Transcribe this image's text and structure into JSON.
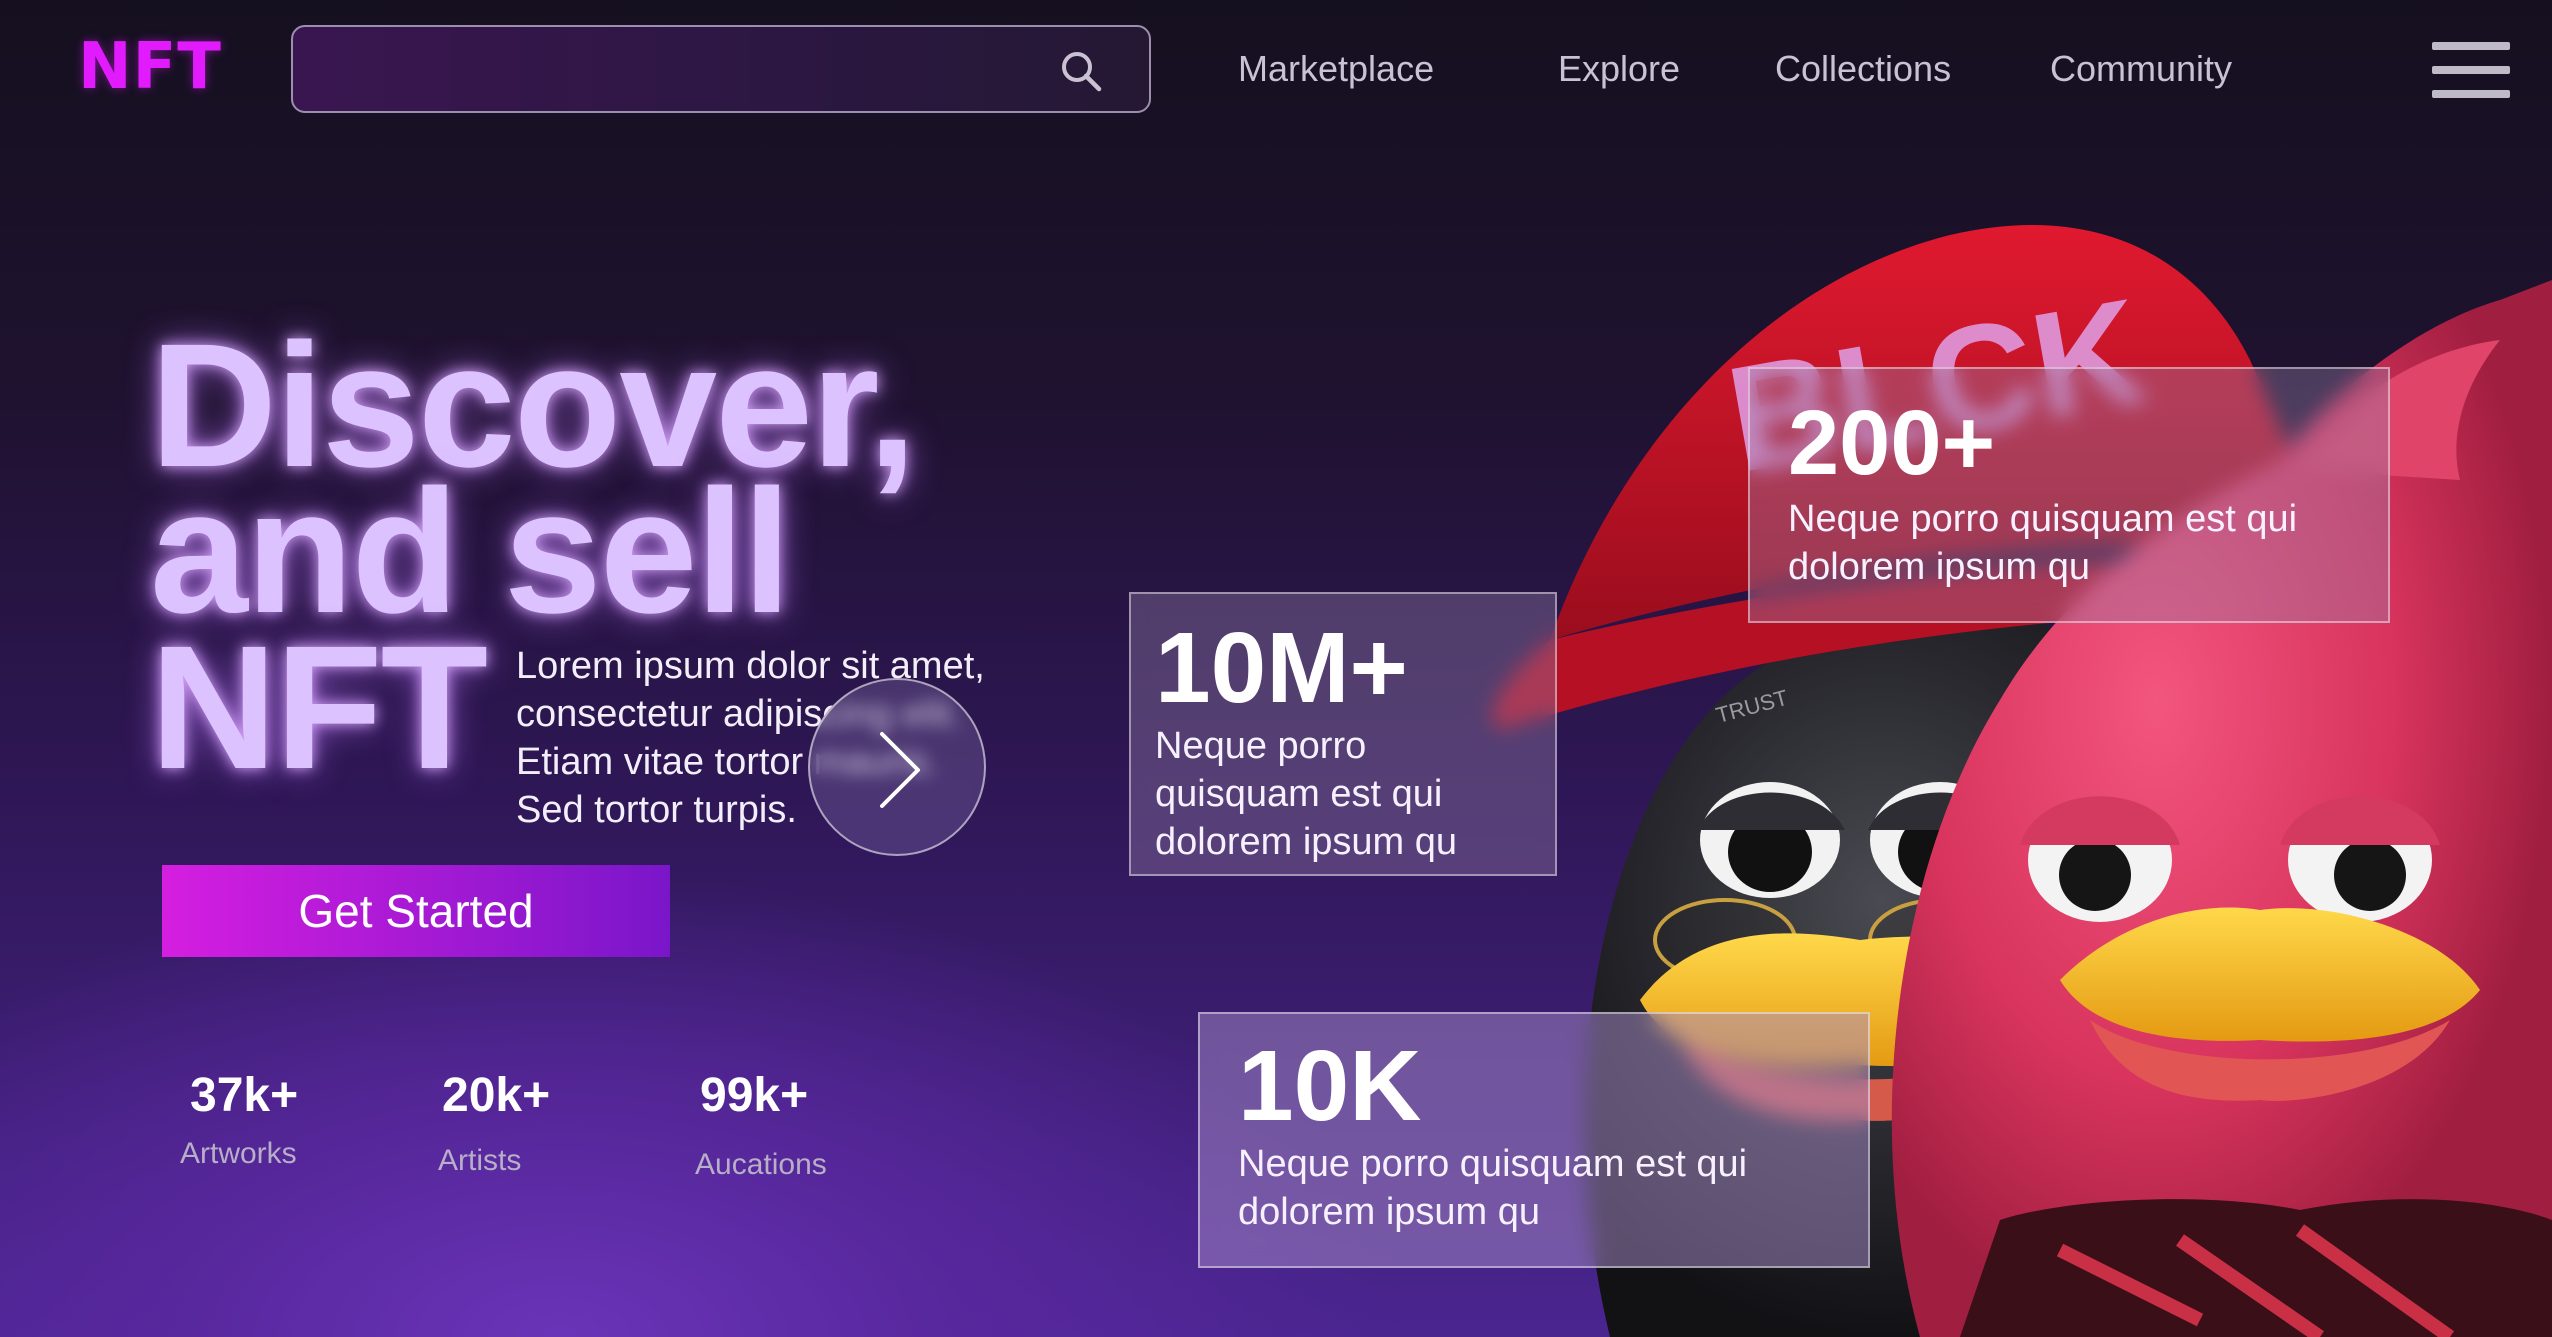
{
  "header": {
    "logo": "NFT",
    "search": {
      "placeholder": "",
      "icon": "search-icon"
    },
    "nav": [
      "Marketplace",
      "Explore",
      "Collections",
      "Community"
    ],
    "menu_icon": "hamburger-menu-icon"
  },
  "hero": {
    "title_line1": "Discover,",
    "title_line2": "and sell",
    "title_line3": "NFT",
    "description_lines": [
      "Lorem ipsum dolor sit amet,",
      "consectetur adipiscing elit.",
      "Etiam vitae  tortor mauris.",
      "Sed tortor turpis."
    ],
    "cta_label": "Get Started",
    "arrow_icon": "chevron-right-icon"
  },
  "stats": [
    {
      "value": "37k+",
      "label": "Artworks"
    },
    {
      "value": "20k+",
      "label": "Artists"
    },
    {
      "value": "99k+",
      "label": "Aucations"
    }
  ],
  "cards": [
    {
      "value": "200+",
      "description": "Neque porro quisquam est qui dolorem ipsum qu"
    },
    {
      "value": "10M+",
      "description": "Neque porro quisquam est qui dolorem ipsum qu"
    },
    {
      "value": "10K",
      "description": "Neque porro quisquam est qui dolorem ipsum qu"
    }
  ],
  "artwork": {
    "hat_text": "BLCK"
  },
  "colors": {
    "accent": "#e21bff",
    "cta_start": "#d51ee0",
    "cta_end": "#7a16c9",
    "title_glow": "#dcc2ff"
  }
}
